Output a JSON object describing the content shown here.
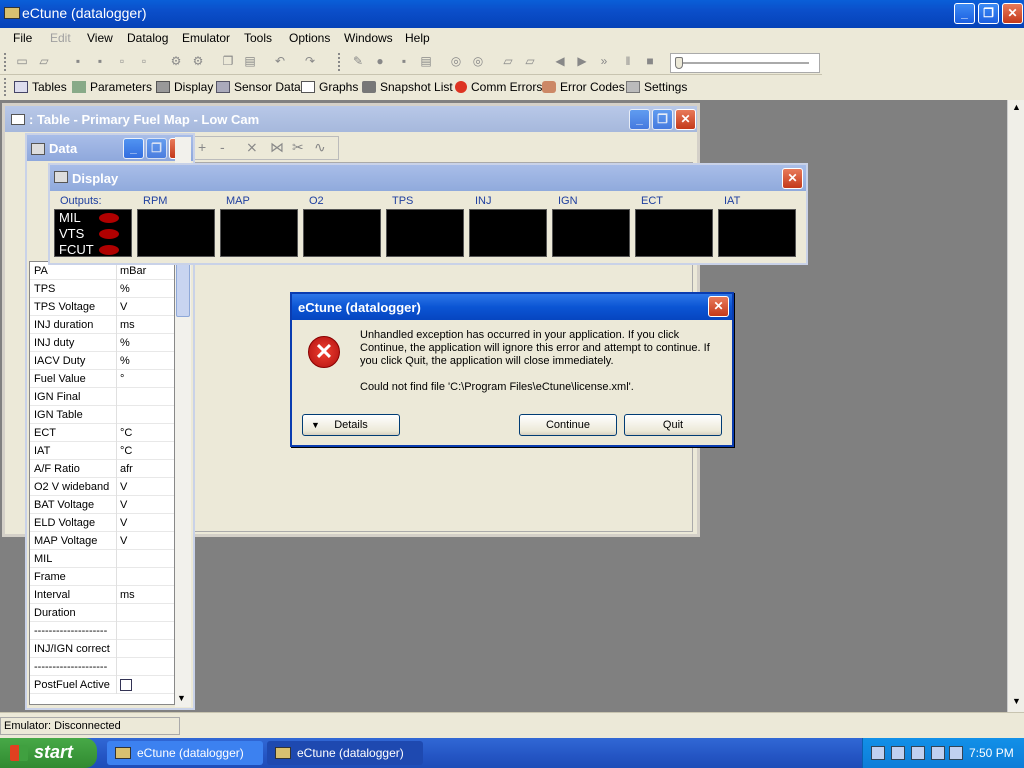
{
  "app": {
    "title": "eCtune (datalogger)"
  },
  "menu": [
    "File",
    "Edit",
    "View",
    "Datalog",
    "Emulator",
    "Tools",
    "Options",
    "Windows",
    "Help"
  ],
  "toolbar2": {
    "tables": "Tables",
    "parameters": "Parameters",
    "display": "Display",
    "sensor_data": "Sensor Data",
    "graphs": "Graphs",
    "snapshot_list": "Snapshot List",
    "comm_errors": "Comm Errors",
    "error_codes": "Error Codes",
    "settings": "Settings"
  },
  "table_window": {
    "title": ": Table - Primary Fuel Map - Low Cam"
  },
  "data_window": {
    "title": "Data",
    "rows": [
      {
        "name": "PA",
        "unit": "mBar"
      },
      {
        "name": "TPS",
        "unit": "%"
      },
      {
        "name": "TPS Voltage",
        "unit": "V"
      },
      {
        "name": "INJ duration",
        "unit": "ms"
      },
      {
        "name": "INJ duty",
        "unit": "%"
      },
      {
        "name": "IACV Duty",
        "unit": "%"
      },
      {
        "name": "Fuel Value",
        "unit": "°"
      },
      {
        "name": "IGN Final",
        "unit": ""
      },
      {
        "name": "IGN Table",
        "unit": ""
      },
      {
        "name": "ECT",
        "unit": "°C"
      },
      {
        "name": "IAT",
        "unit": "°C"
      },
      {
        "name": "A/F Ratio",
        "unit": "afr"
      },
      {
        "name": "O2 V wideband",
        "unit": "V"
      },
      {
        "name": "BAT Voltage",
        "unit": "V"
      },
      {
        "name": "ELD Voltage",
        "unit": "V"
      },
      {
        "name": "MAP Voltage",
        "unit": "V"
      },
      {
        "name": "MIL",
        "unit": ""
      },
      {
        "name": "Frame",
        "unit": ""
      },
      {
        "name": "Interval",
        "unit": "ms"
      },
      {
        "name": "Duration",
        "unit": ""
      },
      {
        "name": "--------------------",
        "unit": ""
      },
      {
        "name": "INJ/IGN correct",
        "unit": ""
      },
      {
        "name": "--------------------",
        "unit": ""
      },
      {
        "name": "PostFuel Active",
        "unit": ""
      }
    ]
  },
  "display_window": {
    "title": "Display",
    "outputs_label": "Outputs:",
    "outputs": [
      "MIL",
      "VTS",
      "FCUT"
    ],
    "gauges": [
      "RPM",
      "MAP",
      "O2",
      "TPS",
      "INJ",
      "IGN",
      "ECT",
      "IAT"
    ]
  },
  "dialog": {
    "title": "eCtune (datalogger)",
    "message": "Unhandled exception has occurred in your application. If you click Continue, the application will ignore this error and attempt to continue. If you click Quit, the application will close immediately.",
    "detail": "Could not find file 'C:\\Program Files\\eCtune\\license.xml'.",
    "details_button": "Details",
    "continue_button": "Continue",
    "quit_button": "Quit"
  },
  "status": {
    "emulator": "Emulator: Disconnected"
  },
  "taskbar": {
    "start": "start",
    "tasks": [
      "eCtune (datalogger)",
      "eCtune (datalogger)"
    ],
    "clock": "7:50 PM"
  }
}
